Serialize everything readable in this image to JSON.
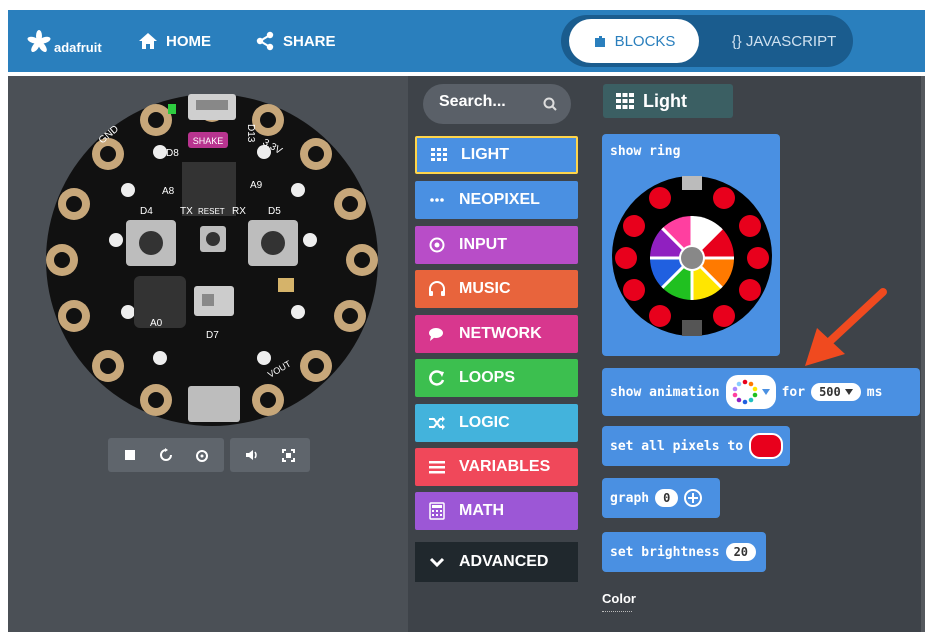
{
  "header": {
    "logo_text": "adafruit",
    "home_label": "HOME",
    "share_label": "SHARE",
    "mode_blocks_label": "BLOCKS",
    "mode_js_label": "{} JAVASCRIPT"
  },
  "simulator": {
    "board_labels": {
      "gnd_top": "GND",
      "d8": "D8",
      "shake": "SHAKE",
      "d13": "D13",
      "v33_top": "3.3V",
      "a9": "A9",
      "a8": "A8",
      "d4": "D4",
      "tx": "TX",
      "reset": "RESET",
      "rx": "RX",
      "d5": "D5",
      "a0": "A0",
      "d7": "D7",
      "vout": "VOUT"
    },
    "controls": [
      "stop-icon",
      "restart-icon",
      "slow-mo-icon",
      "sound-icon",
      "fullscreen-icon"
    ]
  },
  "toolbox": {
    "search_placeholder": "Search...",
    "categories": [
      {
        "label": "LIGHT",
        "color": "#4a90e2",
        "icon": "grid-icon"
      },
      {
        "label": "NEOPIXEL",
        "color": "#4a90e2",
        "icon": "dots-icon"
      },
      {
        "label": "INPUT",
        "color": "#b84dc8",
        "icon": "target-icon"
      },
      {
        "label": "MUSIC",
        "color": "#e8643c",
        "icon": "headphones-icon"
      },
      {
        "label": "NETWORK",
        "color": "#d8378e",
        "icon": "chat-icon"
      },
      {
        "label": "LOOPS",
        "color": "#3cbf4f",
        "icon": "loop-icon"
      },
      {
        "label": "LOGIC",
        "color": "#43b3dc",
        "icon": "shuffle-icon"
      },
      {
        "label": "VARIABLES",
        "color": "#f0485a",
        "icon": "list-icon"
      },
      {
        "label": "MATH",
        "color": "#9c57d6",
        "icon": "calculator-icon"
      }
    ],
    "advanced_label": "ADVANCED"
  },
  "flyout": {
    "title": "Light",
    "blocks": {
      "show_ring": "show ring",
      "show_animation": "show animation",
      "for_label": "for",
      "duration": "500",
      "ms_label": "ms",
      "set_all_pixels": "set all pixels to",
      "pixel_color": "#e8001c",
      "graph_label": "graph",
      "graph_value": "0",
      "set_brightness": "set brightness",
      "brightness_value": "20"
    },
    "section_label": "Color"
  }
}
